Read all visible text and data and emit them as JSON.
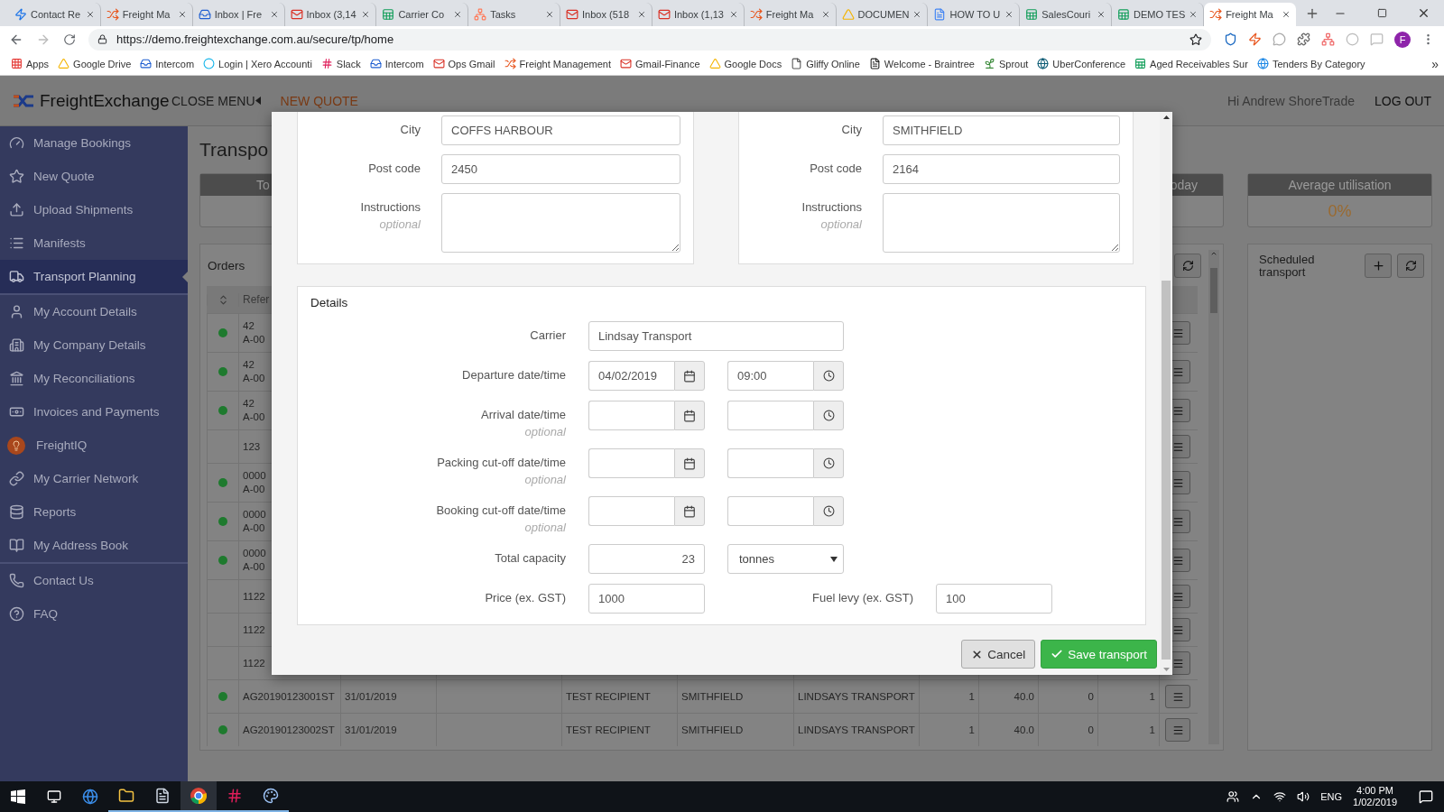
{
  "browser": {
    "tabs": [
      {
        "title": "Contact Re",
        "selected": false
      },
      {
        "title": "Freight Ma",
        "selected": false
      },
      {
        "title": "Inbox | Fre",
        "selected": false
      },
      {
        "title": "Inbox (3,14",
        "selected": false
      },
      {
        "title": "Carrier Co",
        "selected": false
      },
      {
        "title": "Tasks",
        "selected": false
      },
      {
        "title": "Inbox (518",
        "selected": false
      },
      {
        "title": "Inbox (1,13",
        "selected": false
      },
      {
        "title": "Freight Ma",
        "selected": false
      },
      {
        "title": "DOCUMEN",
        "selected": false
      },
      {
        "title": "HOW TO U",
        "selected": false
      },
      {
        "title": "SalesCouri",
        "selected": false
      },
      {
        "title": "DEMO TES",
        "selected": false
      },
      {
        "title": "Freight Ma",
        "selected": true
      }
    ],
    "url": "https://demo.freightexchange.com.au/secure/tp/home",
    "profile": "F",
    "bookmarks": [
      "Apps",
      "Google Drive",
      "Intercom",
      "Login | Xero Accounti",
      "Slack",
      "Intercom",
      "Ops Gmail",
      "Freight Management",
      "Gmail-Finance",
      "Google Docs",
      "Gliffy Online",
      "Welcome - Braintree",
      "Sprout",
      "UberConference",
      "Aged Receivables Sur",
      "Tenders By Category"
    ],
    "bookmarks_more": "»"
  },
  "header": {
    "brand": "FreightExchange",
    "menu_toggle": "CLOSE MENU",
    "new_quote": "NEW QUOTE",
    "greeting": "Hi Andrew ShoreTrade",
    "logout": "LOG OUT"
  },
  "sidebar": {
    "groups": [
      [
        {
          "label": "Manage Bookings",
          "selected": false
        },
        {
          "label": "New Quote",
          "selected": false
        },
        {
          "label": "Upload Shipments",
          "selected": false
        },
        {
          "label": "Manifests",
          "selected": false
        },
        {
          "label": "Transport Planning",
          "selected": true
        }
      ],
      [
        {
          "label": "My Account Details",
          "selected": false
        },
        {
          "label": "My Company Details",
          "selected": false
        },
        {
          "label": "My Reconciliations",
          "selected": false
        },
        {
          "label": "Invoices and Payments",
          "selected": false
        },
        {
          "label": "FreightIQ",
          "selected": false
        },
        {
          "label": "My Carrier Network",
          "selected": false
        },
        {
          "label": "Reports",
          "selected": false
        },
        {
          "label": "My Address Book",
          "selected": false
        }
      ],
      [
        {
          "label": "Contact Us",
          "selected": false
        },
        {
          "label": "FAQ",
          "selected": false
        }
      ]
    ]
  },
  "page": {
    "title": "Transpo",
    "stat_cards": [
      {
        "title": "To"
      },
      {
        "title": "oday"
      },
      {
        "title": "Average utilisation",
        "value": "0%"
      }
    ],
    "orders": {
      "title": "Orders",
      "columns": [
        "Refer"
      ],
      "rows": [
        {
          "status": true,
          "reference": [
            "42",
            "A-00"
          ]
        },
        {
          "status": true,
          "reference": [
            "42",
            "A-00"
          ]
        },
        {
          "status": true,
          "reference": [
            "42",
            "A-00"
          ]
        },
        {
          "status": false,
          "reference": [
            "123"
          ]
        },
        {
          "status": true,
          "reference": [
            "0000",
            "A-00"
          ]
        },
        {
          "status": true,
          "reference": [
            "0000",
            "A-00"
          ]
        },
        {
          "status": true,
          "reference": [
            "0000",
            "A-00"
          ]
        },
        {
          "status": false,
          "reference": [
            "1122"
          ]
        },
        {
          "status": false,
          "reference": [
            "1122"
          ]
        },
        {
          "status": false,
          "reference": [
            "1122"
          ]
        },
        {
          "status": true,
          "reference": [
            "AG20190123001ST"
          ],
          "column_3": "31/01/2019",
          "column_5": "TEST RECIPIENT",
          "column_6": "SMITHFIELD",
          "column_7": "LINDSAYS TRANSPORT",
          "column_8": "1",
          "column_9": "40.0",
          "column_10": "0",
          "column_11": "1"
        },
        {
          "status": true,
          "reference": [
            "AG20190123002ST"
          ],
          "column_3": "31/01/2019",
          "column_5": "TEST RECIPIENT",
          "column_6": "SMITHFIELD",
          "column_7": "LINDSAYS TRANSPORT",
          "column_8": "1",
          "column_9": "40.0",
          "column_10": "0",
          "column_11": "1"
        }
      ]
    },
    "scheduled": {
      "title": "Scheduled transport"
    }
  },
  "modal": {
    "addresses": [
      [
        {
          "kind": "input",
          "label": "City",
          "value": "COFFS HARBOUR"
        },
        {
          "kind": "input",
          "label": "Post code",
          "value": "2450"
        },
        {
          "kind": "textarea",
          "label": "Instructions",
          "hint": "optional"
        }
      ],
      [
        {
          "kind": "input",
          "label": "City",
          "value": "SMITHFIELD"
        },
        {
          "kind": "input",
          "label": "Post code",
          "value": "2164"
        },
        {
          "kind": "textarea",
          "label": "Instructions",
          "hint": "optional"
        }
      ]
    ],
    "details": {
      "title": "Details",
      "rows": [
        {
          "kind": "text",
          "label": "Carrier",
          "value": "Lindsay Transport"
        },
        {
          "kind": "datetime",
          "label": "Departure date/time",
          "date": "04/02/2019",
          "time": "09:00"
        },
        {
          "kind": "datetime",
          "label": "Arrival date/time",
          "hint": "optional"
        },
        {
          "kind": "datetime",
          "label": "Packing cut-off date/time",
          "hint": "optional"
        },
        {
          "kind": "datetime",
          "label": "Booking cut-off date/time",
          "hint": "optional"
        },
        {
          "kind": "quantity",
          "label": "Total capacity",
          "value": "23",
          "unit": "tonnes"
        },
        {
          "kind": "money",
          "label": "Price (ex. GST)",
          "value": "1000",
          "second_label": "Fuel levy (ex. GST)",
          "second_value": "100"
        }
      ]
    },
    "buttons": [
      {
        "kind": "secondary",
        "label": "Cancel"
      },
      {
        "kind": "primary",
        "label": "Save transport"
      }
    ]
  },
  "taskbar": {
    "language": "ENG",
    "time": "4:00 PM",
    "date": "1/02/2019"
  }
}
